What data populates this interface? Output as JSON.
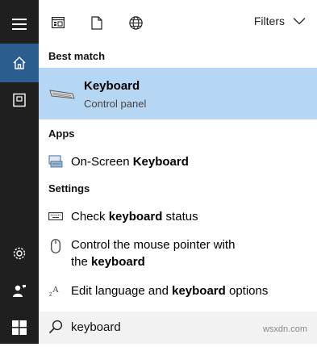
{
  "topbar": {
    "icons": [
      "apps-filter-icon",
      "documents-filter-icon",
      "web-filter-icon"
    ],
    "filters_label": "Filters"
  },
  "sections": {
    "best_match": "Best match",
    "apps": "Apps",
    "settings": "Settings"
  },
  "best_match": {
    "title": "Keyboard",
    "subtitle": "Control panel"
  },
  "apps": [
    {
      "pre": "On-Screen ",
      "bold": "Keyboard",
      "post": ""
    }
  ],
  "settings": [
    {
      "pre": "Check ",
      "bold": "keyboard",
      "post": " status"
    },
    {
      "pre": "Control the mouse pointer with",
      "line2_pre": "the ",
      "bold": "keyboard",
      "post": ""
    },
    {
      "pre": "Edit language and ",
      "bold": "keyboard",
      "post": " options"
    }
  ],
  "search": {
    "query": "keyboard"
  },
  "watermark": "wsxdn.com",
  "colors": {
    "sidebar": "#1f1f1f",
    "active": "#2b5d8f",
    "selection": "#b5d7f3"
  }
}
